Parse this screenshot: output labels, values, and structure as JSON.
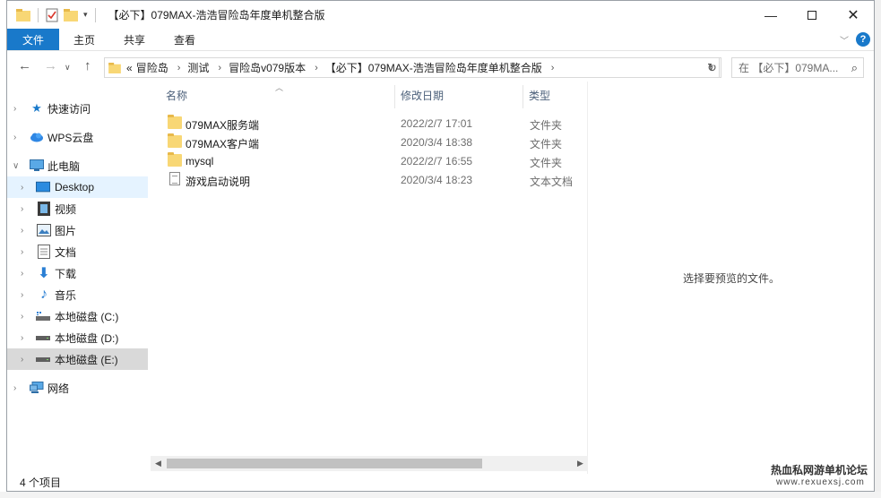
{
  "window": {
    "title": "【必下】079MAX-浩浩冒险岛年度单机整合版",
    "controls": [
      "minimize",
      "maximize",
      "close"
    ]
  },
  "ribbon": {
    "tabs": [
      "文件",
      "主页",
      "共享",
      "查看"
    ],
    "help": "?"
  },
  "address": {
    "overflow": "«",
    "crumbs": [
      "冒险岛",
      "测试",
      "冒险岛v079版本",
      "【必下】079MAX-浩浩冒险岛年度单机整合版"
    ],
    "search_placeholder": "在 【必下】079MA..."
  },
  "sidebar": {
    "items": [
      {
        "label": "快速访问",
        "icon": "star-icon"
      },
      {
        "label": "WPS云盘",
        "icon": "cloud-icon"
      },
      {
        "label": "此电脑",
        "icon": "computer-icon"
      },
      {
        "label": "Desktop",
        "icon": "desktop-icon"
      },
      {
        "label": "视频",
        "icon": "video-icon"
      },
      {
        "label": "图片",
        "icon": "picture-icon"
      },
      {
        "label": "文档",
        "icon": "documents-icon"
      },
      {
        "label": "下载",
        "icon": "download-icon"
      },
      {
        "label": "音乐",
        "icon": "music-icon"
      },
      {
        "label": "本地磁盘 (C:)",
        "icon": "drive-c-icon"
      },
      {
        "label": "本地磁盘 (D:)",
        "icon": "drive-icon"
      },
      {
        "label": "本地磁盘 (E:)",
        "icon": "drive-icon"
      },
      {
        "label": "网络",
        "icon": "network-icon"
      }
    ]
  },
  "columns": {
    "name": "名称",
    "modified": "修改日期",
    "type": "类型"
  },
  "files": [
    {
      "name": "079MAX服务端",
      "modified": "2022/2/7 17:01",
      "type": "文件夹",
      "kind": "folder"
    },
    {
      "name": "079MAX客户端",
      "modified": "2020/3/4 18:38",
      "type": "文件夹",
      "kind": "folder"
    },
    {
      "name": "mysql",
      "modified": "2022/2/7 16:55",
      "type": "文件夹",
      "kind": "folder"
    },
    {
      "name": "游戏启动说明",
      "modified": "2020/3/4 18:23",
      "type": "文本文档",
      "kind": "text"
    }
  ],
  "preview": {
    "text": "选择要预览的文件。"
  },
  "status": {
    "count": "4 个项目"
  },
  "watermark": {
    "line1": "热血私网游单机论坛",
    "line2": "www.rexuexsj.com"
  },
  "colors": {
    "accent": "#1979ca",
    "selected_bg": "#e5f3ff",
    "folder": "#f8d775"
  }
}
